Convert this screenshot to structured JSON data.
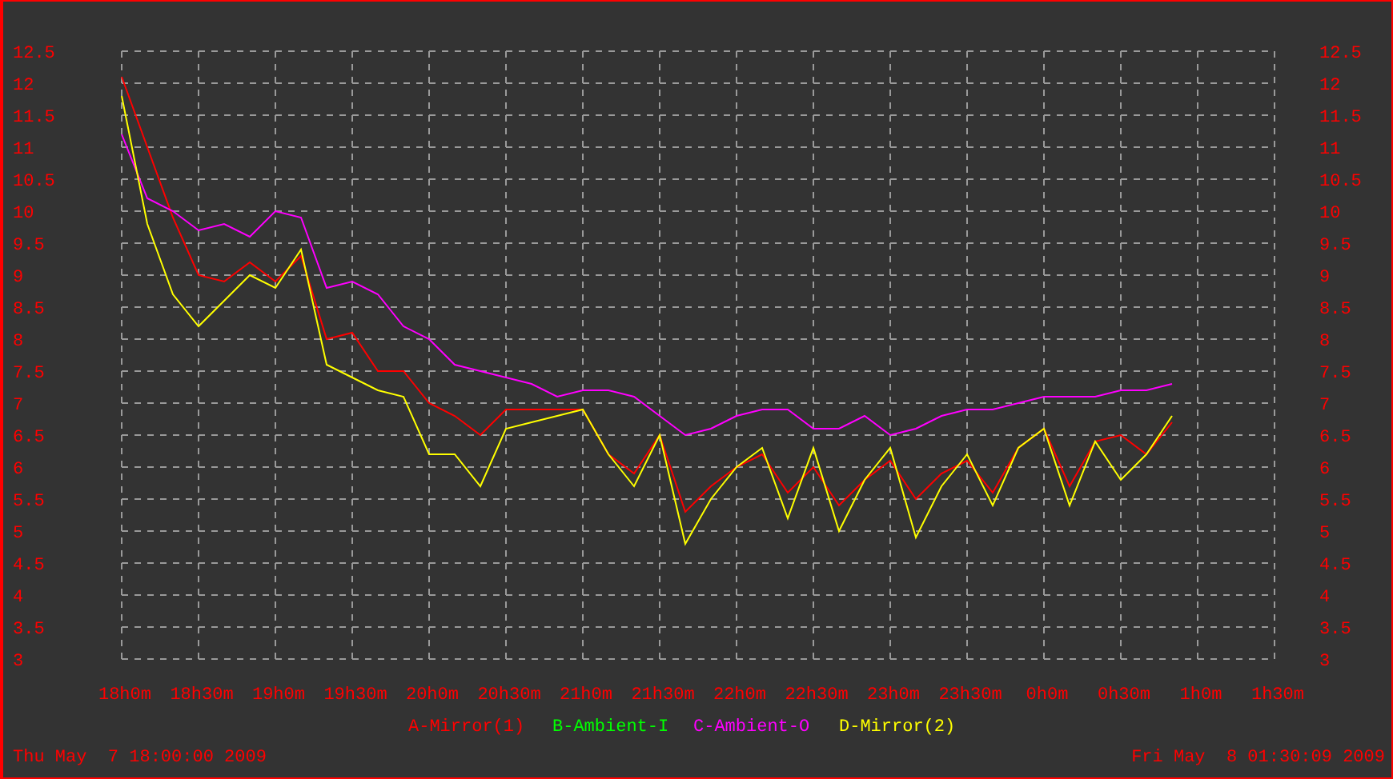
{
  "chart_data": {
    "type": "line",
    "grid": true,
    "ylim": [
      3,
      12.5
    ],
    "categories": [
      "18h0m",
      null,
      null,
      "18h30m",
      null,
      null,
      "19h0m",
      null,
      null,
      "19h30m",
      null,
      null,
      "20h0m",
      null,
      null,
      "20h30m",
      null,
      null,
      "21h0m",
      null,
      null,
      "21h30m",
      null,
      null,
      "22h0m",
      null,
      null,
      "22h30m",
      null,
      null,
      "23h0m",
      null,
      null,
      "23h30m",
      null,
      null,
      "0h0m",
      null,
      null,
      "0h30m",
      null,
      null,
      "1h0m",
      null,
      null,
      "1h30m"
    ],
    "yticks": [
      3,
      3.5,
      4,
      4.5,
      5,
      5.5,
      6,
      6.5,
      7,
      7.5,
      8,
      8.5,
      9,
      9.5,
      10,
      10.5,
      11,
      11.5,
      12,
      12.5
    ],
    "y2lim": [
      3,
      12.5
    ],
    "y2ticks": [
      3,
      3.5,
      4,
      4.5,
      5,
      5.5,
      6,
      6.5,
      7,
      7.5,
      8,
      8.5,
      9,
      9.5,
      10,
      10.5,
      11,
      11.5,
      12,
      12.5
    ],
    "series": [
      {
        "name": "A-Mirror(1)",
        "color": "#ff0000",
        "values": [
          12.1,
          11.0,
          9.9,
          9.0,
          8.9,
          9.2,
          8.9,
          9.3,
          8.0,
          8.1,
          7.5,
          7.5,
          7.0,
          6.8,
          6.5,
          6.9,
          6.9,
          6.9,
          6.9,
          6.2,
          5.9,
          6.5,
          5.3,
          5.7,
          6.0,
          6.2,
          5.6,
          6.0,
          5.4,
          5.8,
          6.1,
          5.5,
          5.9,
          6.1,
          5.6,
          6.3,
          6.6,
          5.7,
          6.4,
          6.5,
          6.2,
          6.7,
          null,
          null,
          null,
          null
        ]
      },
      {
        "name": "B-Ambient-I",
        "color": "#00ff00",
        "values": [
          null,
          null,
          null,
          null,
          null,
          null,
          null,
          null,
          null,
          null,
          null,
          null,
          null,
          null,
          null,
          null,
          null,
          null,
          null,
          null,
          null,
          null,
          null,
          null,
          null,
          null,
          null,
          null,
          null,
          null,
          null,
          null,
          null,
          null,
          null,
          null,
          null,
          null,
          null,
          null,
          null,
          null,
          null,
          null,
          null,
          null
        ]
      },
      {
        "name": "C-Ambient-O",
        "color": "#ff00ff",
        "values": [
          11.2,
          10.2,
          10.0,
          9.7,
          9.8,
          9.6,
          10.0,
          9.9,
          8.8,
          8.9,
          8.7,
          8.2,
          8.0,
          7.6,
          7.5,
          7.4,
          7.3,
          7.1,
          7.2,
          7.2,
          7.1,
          6.8,
          6.5,
          6.6,
          6.8,
          6.9,
          6.9,
          6.6,
          6.6,
          6.8,
          6.5,
          6.6,
          6.8,
          6.9,
          6.9,
          7.0,
          7.1,
          7.1,
          7.1,
          7.2,
          7.2,
          7.3,
          null,
          null,
          null,
          null
        ]
      },
      {
        "name": "D-Mirror(2)",
        "color": "#ffff00",
        "values": [
          11.8,
          9.8,
          8.7,
          8.2,
          8.6,
          9.0,
          8.8,
          9.4,
          7.6,
          7.4,
          7.2,
          7.1,
          6.2,
          6.2,
          5.7,
          6.6,
          6.7,
          6.8,
          6.9,
          6.2,
          5.7,
          6.5,
          4.8,
          5.5,
          6.0,
          6.3,
          5.2,
          6.3,
          5.0,
          5.8,
          6.3,
          4.9,
          5.7,
          6.2,
          5.4,
          6.3,
          6.6,
          5.4,
          6.4,
          5.8,
          6.2,
          6.8,
          null,
          null,
          null,
          null
        ]
      }
    ]
  },
  "footer": {
    "start_time": "Thu May  7 18:00:00 2009",
    "end_time": "Fri May  8 01:30:09 2009"
  }
}
